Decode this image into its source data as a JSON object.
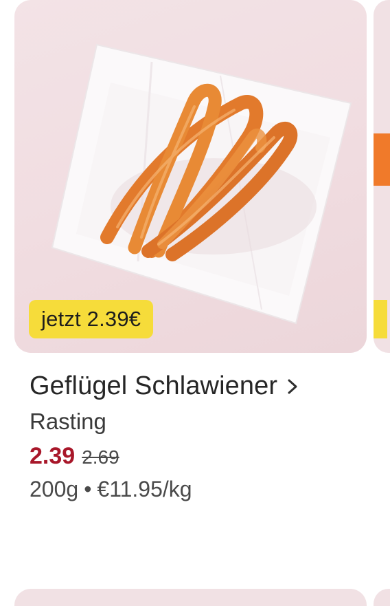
{
  "product": {
    "badge_text": "jetzt 2.39€",
    "title": "Geflügel Schlawiener",
    "brand": "Rasting",
    "price_current": "2.39",
    "price_old": "2.69",
    "size": "200g",
    "separator": "•",
    "unit_price": "€11.95/kg",
    "image_icon": "sausages-on-paper-image",
    "chevron_icon": "chevron-right-icon"
  },
  "colors": {
    "badge_bg": "#f6dc3a",
    "price_current": "#a8172a",
    "card_bg": "#f1e1e4",
    "next_card_accent": "#f07a2a"
  }
}
